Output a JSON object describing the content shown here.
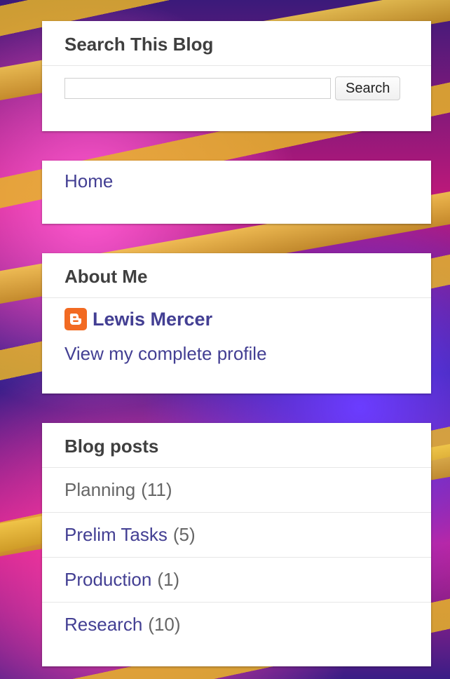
{
  "search_widget": {
    "title": "Search This Blog",
    "input_value": "",
    "button_label": "Search"
  },
  "pages_widget": {
    "home_label": "Home"
  },
  "about_widget": {
    "title": "About Me",
    "profile_name": "Lewis Mercer",
    "profile_link": "View my complete profile",
    "icon": "blogger-icon"
  },
  "labels_widget": {
    "title": "Blog posts",
    "items": [
      {
        "label": "Planning",
        "count": "(11)",
        "current": true
      },
      {
        "label": "Prelim Tasks",
        "count": "(5)",
        "current": false
      },
      {
        "label": "Production",
        "count": "(1)",
        "current": false
      },
      {
        "label": "Research",
        "count": "(10)",
        "current": false
      }
    ]
  },
  "colors": {
    "link": "#433f93",
    "title": "#3f3f3f",
    "blogger_orange": "#f26a22"
  }
}
